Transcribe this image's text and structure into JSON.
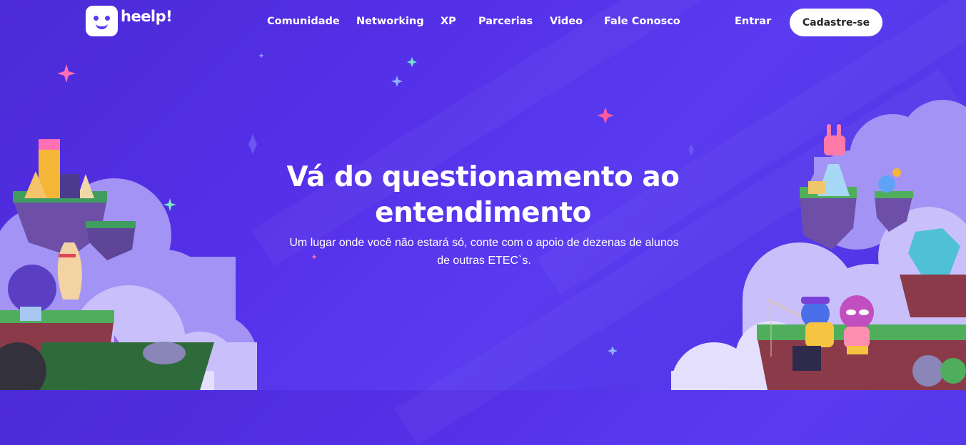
{
  "brand": {
    "name": "heelp!",
    "logo_icon": "smiling-face-icon"
  },
  "nav": {
    "items": [
      "Comunidade",
      "Networking",
      "XP",
      "Parcerias",
      "Video",
      "Fale Conosco"
    ],
    "login": "Entrar",
    "signup": "Cadastre-se"
  },
  "hero": {
    "title_line1": "Vá do questionamento ao",
    "title_line2": "entendimento",
    "subtitle_line1": "Um lugar onde você não estará só, conte com o apoio de dezenas de alunos",
    "subtitle_line2": "de outras ETEC`s."
  },
  "colors": {
    "background": "#5430e8",
    "cloud": "#ab9cf5",
    "button_bg": "#ffffff",
    "button_text": "#23272a"
  }
}
